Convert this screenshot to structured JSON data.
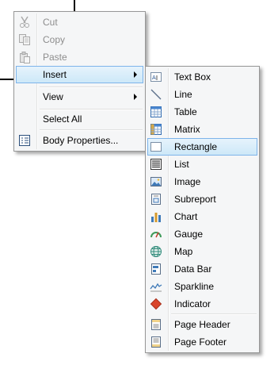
{
  "context_menu": {
    "cut": "Cut",
    "copy": "Copy",
    "paste": "Paste",
    "insert": "Insert",
    "view": "View",
    "select_all": "Select All",
    "body_properties": "Body Properties..."
  },
  "insert_submenu": {
    "text_box": "Text Box",
    "line": "Line",
    "table": "Table",
    "matrix": "Matrix",
    "rectangle": "Rectangle",
    "list": "List",
    "image": "Image",
    "subreport": "Subreport",
    "chart": "Chart",
    "gauge": "Gauge",
    "map": "Map",
    "data_bar": "Data Bar",
    "sparkline": "Sparkline",
    "indicator": "Indicator",
    "page_header": "Page Header",
    "page_footer": "Page Footer"
  },
  "state": {
    "highlighted_main": "Insert",
    "highlighted_sub": "Rectangle",
    "disabled_items": [
      "Cut",
      "Copy",
      "Paste"
    ]
  },
  "colors": {
    "menu_bg": "#f5f6f7",
    "highlight_border": "#7eb4ea",
    "highlight_fill": "#cde8f8",
    "disabled_text": "#8d8d8d"
  }
}
